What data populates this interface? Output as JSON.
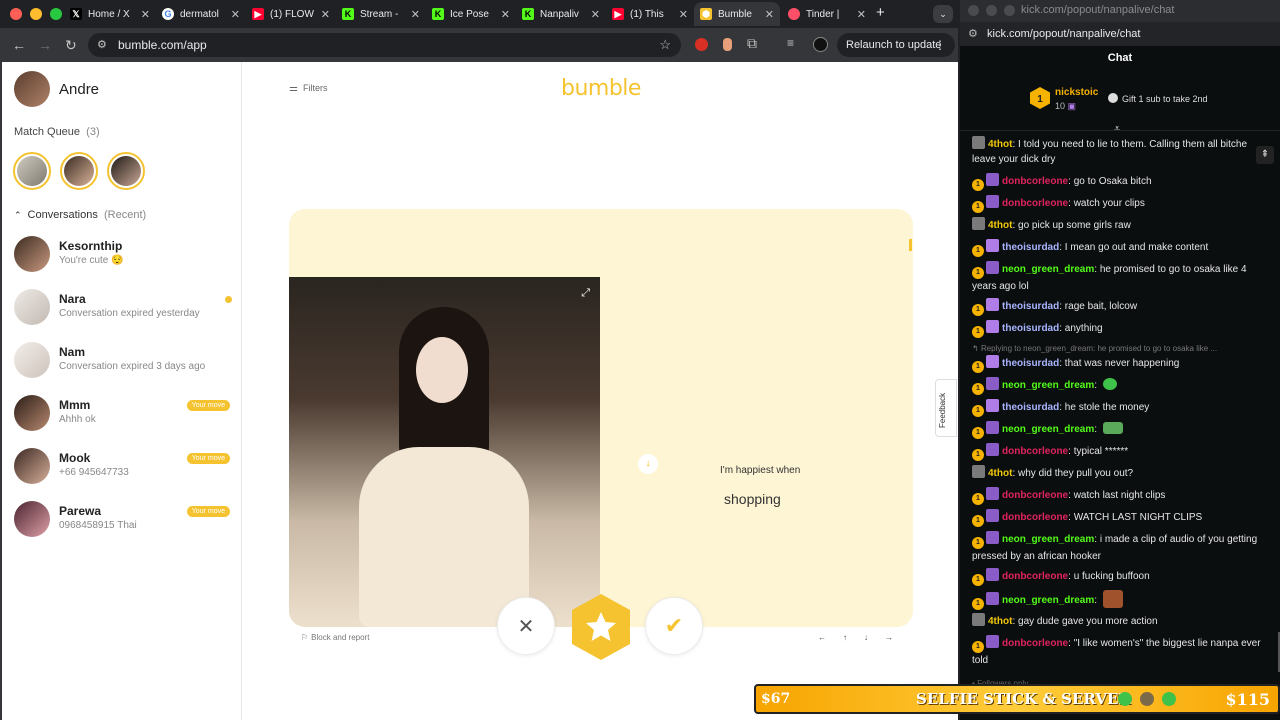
{
  "tabs": [
    {
      "label": "Home / X",
      "icon": "x-icon"
    },
    {
      "label": "dermatol",
      "icon": "google-icon"
    },
    {
      "label": "(1) FLOW",
      "icon": "youtube-icon"
    },
    {
      "label": "Stream -",
      "icon": "kick-icon"
    },
    {
      "label": "Ice Pose",
      "icon": "kick-icon"
    },
    {
      "label": "Nanpaliv",
      "icon": "kick-icon"
    },
    {
      "label": "(1) This",
      "icon": "youtube-icon"
    },
    {
      "label": "Bumble",
      "icon": "bumble-icon"
    },
    {
      "label": "Tinder |",
      "icon": "tinder-icon"
    }
  ],
  "toolbar": {
    "url": "bumble.com/app",
    "relaunch_label": "Relaunch to update"
  },
  "sidebar": {
    "user_name": "Andre",
    "match_queue_label": "Match Queue",
    "match_queue_count": "(3)",
    "conversations_label": "Conversations",
    "conversations_sub": "(Recent)",
    "conversations": [
      {
        "name": "Kesornthip",
        "preview": "You're cute 😌",
        "badge": ""
      },
      {
        "name": "Nara",
        "preview": "Conversation expired yesterday",
        "badge": ""
      },
      {
        "name": "Nam",
        "preview": "Conversation expired 3 days ago",
        "badge": ""
      },
      {
        "name": "Mmm",
        "preview": "Ahhh ok",
        "badge": "Your move"
      },
      {
        "name": "Mook",
        "preview": "+66 945647733",
        "badge": "Your move"
      },
      {
        "name": "Parewa",
        "preview": "0968458915 Thai",
        "badge": "Your move"
      }
    ]
  },
  "main": {
    "filters_label": "Filters",
    "logo": "bumble",
    "prompt_label": "I'm happiest when",
    "prompt_answer": "shopping",
    "block_report_label": "Block and report",
    "feedback_label": "Feedback",
    "nav_arrows": [
      "←",
      "↑",
      "↓",
      "→"
    ]
  },
  "kick": {
    "url": "kick.com/popout/nanpalive/chat",
    "window_title": "kick.com/popout/nanpalive/chat",
    "chat_title": "Chat",
    "top_gifter": {
      "name": "nickstoic",
      "count": "10"
    },
    "gift_cta": "Gift 1 sub to take 2nd",
    "reply_context": "Replying to neon_green_dream: he promised to go to osaka like ...",
    "footer_hint": "Followers only",
    "messages": [
      {
        "user": "4thot",
        "text": "I told you need to lie to them. Calling them all bitche leave your dick dry",
        "color": "#f0c808"
      },
      {
        "user": "donbcorleone",
        "text": "go to Osaka bitch",
        "color": "#e0245e"
      },
      {
        "user": "donbcorleone",
        "text": "watch your clips",
        "color": "#e0245e"
      },
      {
        "user": "4thot",
        "text": "go pick up some girls raw",
        "color": "#f0c808"
      },
      {
        "user": "theoisurdad",
        "text": "I mean go out and make content",
        "color": "#a8b4ff"
      },
      {
        "user": "neon_green_dream",
        "text": "he promised to go to osaka like 4 years ago lol",
        "color": "#53fc18"
      },
      {
        "user": "theoisurdad",
        "text": "rage bait, lolcow",
        "color": "#a8b4ff"
      },
      {
        "user": "theoisurdad",
        "text": "anything",
        "color": "#a8b4ff"
      },
      {
        "user": "theoisurdad",
        "text": "that was never happening",
        "color": "#a8b4ff"
      },
      {
        "user": "neon_green_dream",
        "text": "",
        "color": "#53fc18"
      },
      {
        "user": "theoisurdad",
        "text": "he stole the money",
        "color": "#a8b4ff"
      },
      {
        "user": "neon_green_dream",
        "text": "",
        "color": "#53fc18"
      },
      {
        "user": "donbcorleone",
        "text": "typical ******",
        "color": "#e0245e"
      },
      {
        "user": "4thot",
        "text": "why did they pull you out?",
        "color": "#f0c808"
      },
      {
        "user": "donbcorleone",
        "text": "watch last night clips",
        "color": "#e0245e"
      },
      {
        "user": "donbcorleone",
        "text": "WATCH LAST NIGHT CLIPS",
        "color": "#e0245e"
      },
      {
        "user": "neon_green_dream",
        "text": "i made a clip of audio of you getting pressed by an african hooker",
        "color": "#53fc18"
      },
      {
        "user": "donbcorleone",
        "text": "u fucking buffoon",
        "color": "#e0245e"
      },
      {
        "user": "neon_green_dream",
        "text": "",
        "color": "#53fc18"
      },
      {
        "user": "4thot",
        "text": "gay dude gave you more action",
        "color": "#f0c808"
      },
      {
        "user": "donbcorleone",
        "text": "\"I like women's\" the biggest lie nanpa ever told",
        "color": "#e0245e"
      }
    ]
  },
  "ticker": {
    "left_amount": "$67",
    "headline": "SELFIE STICK & SERVER",
    "right_amount": "$115"
  },
  "colors": {
    "bumble_yellow": "#f5c330",
    "card_bg": "#fdf5d4",
    "kick_green": "#53fc18"
  }
}
